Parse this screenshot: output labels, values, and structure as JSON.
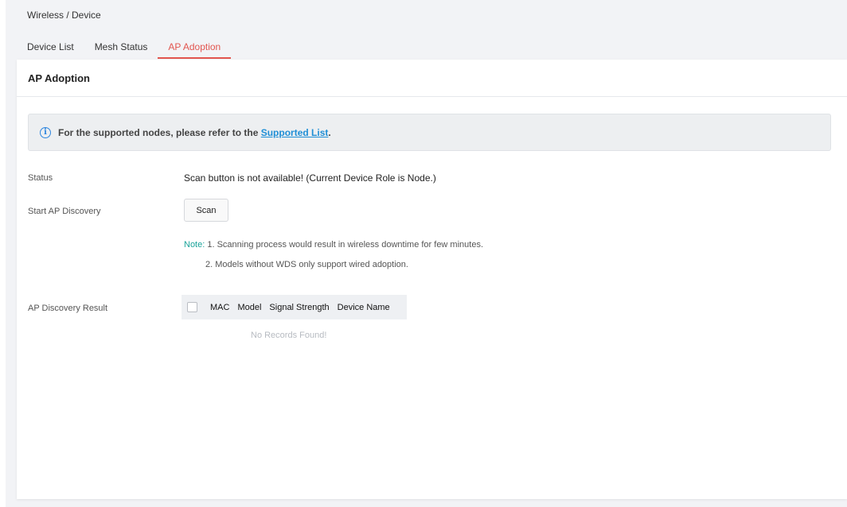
{
  "breadcrumb": "Wireless / Device",
  "tabs": [
    {
      "label": "Device List",
      "active": false
    },
    {
      "label": "Mesh Status",
      "active": false
    },
    {
      "label": "AP Adoption",
      "active": true
    }
  ],
  "panel": {
    "title": "AP Adoption",
    "info": {
      "icon": "info-circle-icon",
      "text": "For the supported nodes, please refer to the ",
      "link": "Supported List",
      "suffix": "."
    },
    "status": {
      "label": "Status",
      "value": "Scan button is not available! (Current Device Role is Node.)"
    },
    "discovery": {
      "label": "Start AP Discovery",
      "button": "Scan",
      "note_label": "Note:",
      "note_line1": " 1. Scanning process would result in wireless downtime for few minutes.",
      "note_line2": "2. Models without WDS only support wired adoption."
    },
    "result": {
      "label": "AP Discovery Result",
      "columns": [
        "MAC",
        "Model",
        "Signal Strength",
        "Device Name"
      ],
      "empty_text": "No Records Found!"
    }
  },
  "colors": {
    "accent_tab": "#e2554f",
    "link": "#1f8fd6",
    "note": "#1aa39a",
    "info_icon": "#2e86de"
  }
}
